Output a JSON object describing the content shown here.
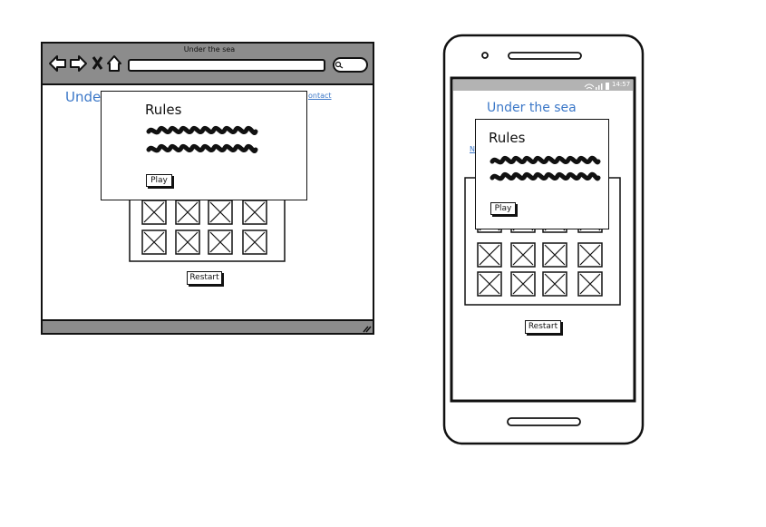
{
  "desktop": {
    "window_title": "Under the sea",
    "page_heading": "Under",
    "nav_contact": "ontact",
    "modal": {
      "title": "Rules",
      "play_label": "Play"
    },
    "restart_label": "Restart"
  },
  "mobile": {
    "status_time": "14:57",
    "page_heading": "Under the sea",
    "nav_fragment": "N",
    "modal": {
      "title": "Rules",
      "play_label": "Play"
    },
    "restart_label": "Restart"
  },
  "colors": {
    "accent": "#3c78c8",
    "chrome": "#8c8c8c",
    "ink": "#111111"
  }
}
